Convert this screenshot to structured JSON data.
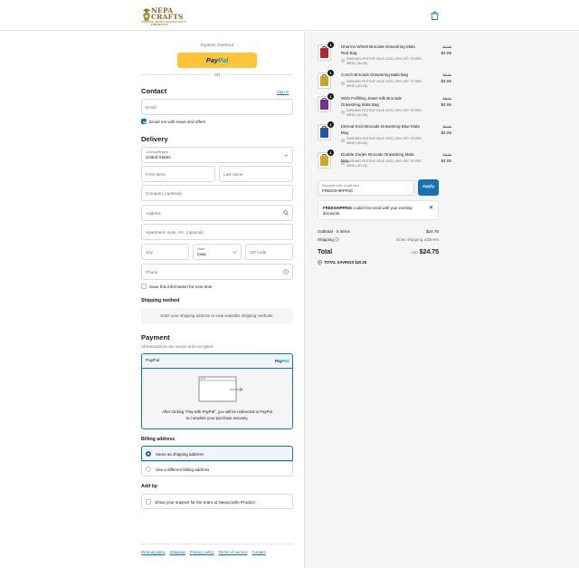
{
  "header": {
    "logo_word_1": "NEPA",
    "logo_word_2": "CRAFTS",
    "logo_word_3": "PRODUCT",
    "logo_tagline": "HANDMADE TIBETAN & NEPALESE CRAFTS"
  },
  "express": {
    "label": "Express checkout",
    "paypal_1": "Pay",
    "paypal_2": "Pal",
    "or": "OR"
  },
  "contact": {
    "heading": "Contact",
    "sign_in": "Sign in",
    "email_placeholder": "Email",
    "newsletter_label": "Email me with news and offers",
    "newsletter_checked": true
  },
  "delivery": {
    "heading": "Delivery",
    "country_label": "Country/Region",
    "country_value": "United States",
    "first_name": "First name",
    "last_name": "Last name",
    "company": "Company (optional)",
    "address": "Address",
    "apartment": "Apartment, suite, etc. (optional)",
    "city": "City",
    "state_label": "State",
    "state_value": "Iowa",
    "zip": "ZIP code",
    "phone": "Phone",
    "save_info": "Save this information for next time"
  },
  "shipping": {
    "heading": "Shipping method",
    "notice": "Enter your shipping address to view available shipping methods."
  },
  "payment": {
    "heading": "Payment",
    "subtitle": "All transactions are secure and encrypted.",
    "method": "PayPal",
    "logo_1": "Pay",
    "logo_2": "Pal",
    "redirect_msg": "After clicking “Pay with PayPal”, you will be redirected to PayPal to complete your purchase securely."
  },
  "billing": {
    "heading": "Billing address",
    "option_same": "Same as shipping address",
    "option_different": "Use a different billing address"
  },
  "tip": {
    "heading": "Add tip",
    "label": "Show your support for the team at NepaCrafts Product"
  },
  "footer": {
    "links": [
      "Refund policy",
      "Shipping",
      "Privacy policy",
      "Terms of service",
      "Contact"
    ]
  },
  "cart": {
    "items": [
      {
        "name": "Dharma Wheel Brocade Drawstring Mala Red Bag",
        "qty": "1",
        "discount": "DASHAIN FESTIVE SALE 2025 | 45% OFF STORE-WIDE (-$4.05)",
        "was": "$9.00",
        "now": "$4.95",
        "color": "#b3262e"
      },
      {
        "name": "Conch Brocade Drawstring Mala Bag",
        "qty": "1",
        "discount": "DASHAIN FESTIVE SALE 2025 | 45% OFF STORE-WIDE (-$4.05)",
        "was": "$9.00",
        "now": "$4.95",
        "color": "#c9a227"
      },
      {
        "name": "Wish Fulfilling Jewel Silk Brocade Drawstring Mala Bag",
        "qty": "1",
        "discount": "DASHAIN FESTIVE SALE 2025 | 45% OFF STORE-WIDE (-$4.05)",
        "was": "$9.00",
        "now": "$4.95",
        "color": "#7a2f8f"
      },
      {
        "name": "Eternal Knot Brocade Drawstring Blue Mala Bag",
        "qty": "1",
        "discount": "DASHAIN FESTIVE SALE 2025 | 45% OFF STORE-WIDE (-$4.05)",
        "was": "$9.00",
        "now": "$4.95",
        "color": "#2456a6"
      },
      {
        "name": "Double Dorjee Brocade Drawstring Mala Bag",
        "qty": "1",
        "discount": "DASHAIN FESTIVE SALE 2025 | 45% OFF STORE-WIDE (-$4.05)",
        "was": "$9.00",
        "now": "$4.95",
        "color": "#d9a51e"
      }
    ],
    "code_label": "Discount code or gift card",
    "code_value": "FREESHIPPING",
    "apply": "Apply",
    "warning_code": "FREESHIPPING",
    "warning_text": " couldn't be used with your existing discounts.",
    "subtotal_label": "Subtotal · 5 items",
    "subtotal_value": "$24.75",
    "shipping_label": "Shipping",
    "shipping_value": "Enter shipping address",
    "total_label": "Total",
    "total_currency": "USD",
    "total_value": "$24.75",
    "savings": "TOTAL SAVINGS  $20.25"
  },
  "colors": {
    "accent": "#1773b0",
    "paypal_yellow": "#ffc439",
    "paypal_dark": "#003087",
    "paypal_light": "#009cde"
  }
}
